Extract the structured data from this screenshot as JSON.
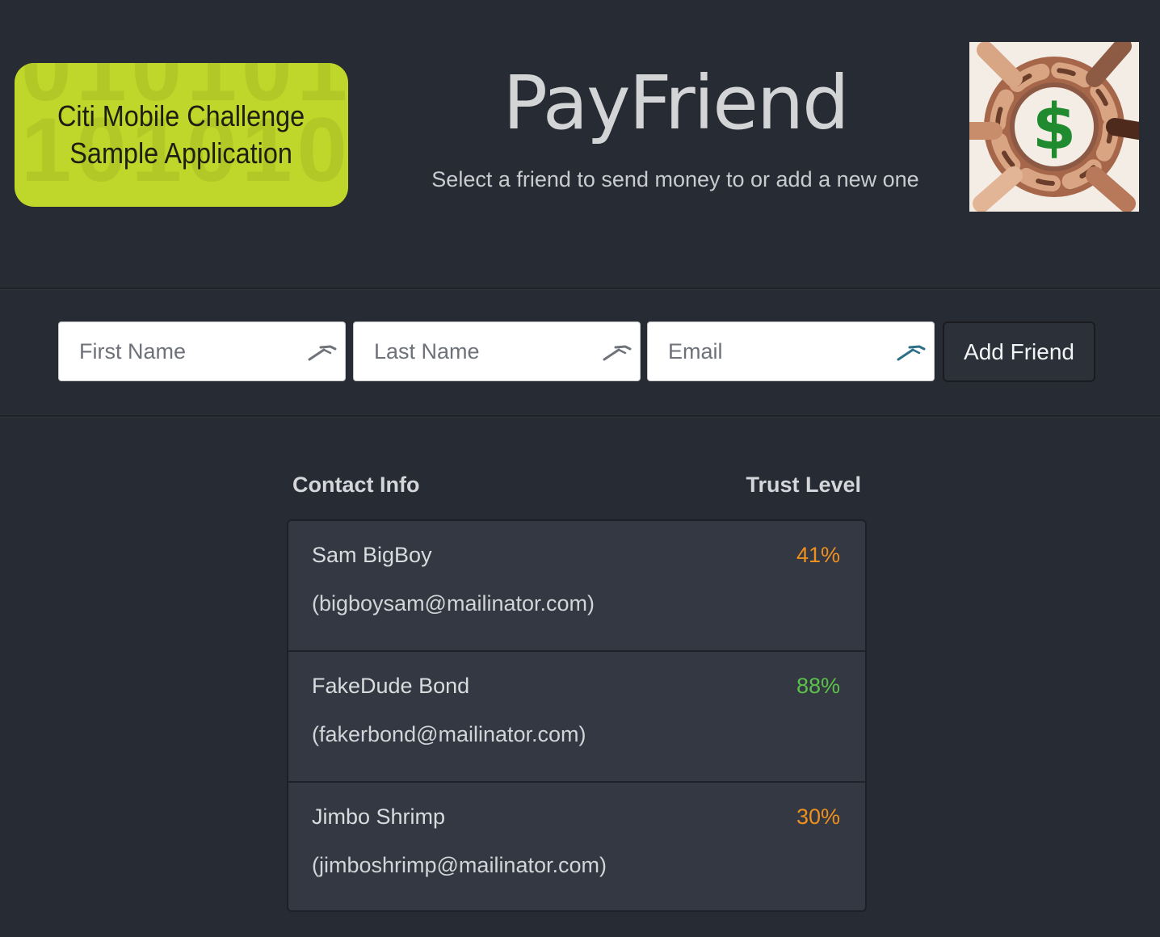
{
  "header": {
    "badge_line1": "Citi Mobile Challenge",
    "badge_line2": "Sample Application",
    "title": "PayFriend",
    "tagline": "Select a friend to send money to or add a new one",
    "logo_icon": "hands-circle-dollar-icon"
  },
  "form": {
    "first_name_placeholder": "First Name",
    "last_name_placeholder": "Last Name",
    "email_placeholder": "Email",
    "first_name_value": "",
    "last_name_value": "",
    "email_value": "",
    "field_icon": "key-icon",
    "add_button_label": "Add Friend"
  },
  "table": {
    "contact_header": "Contact Info",
    "trust_header": "Trust Level"
  },
  "friends": [
    {
      "name": "Sam BigBoy",
      "email": "(bigboysam@mailinator.com)",
      "trust": "41%",
      "trust_color": "#f0901e"
    },
    {
      "name": "FakeDude Bond",
      "email": "(fakerbond@mailinator.com)",
      "trust": "88%",
      "trust_color": "#5cc24a"
    },
    {
      "name": "Jimbo Shrimp",
      "email": "(jimboshrimp@mailinator.com)",
      "trust": "30%",
      "trust_color": "#f0901e"
    }
  ],
  "colors": {
    "background": "#272b33",
    "badge": "#bfd62a",
    "panel": "#333842",
    "dollar": "#1f8a2e"
  }
}
